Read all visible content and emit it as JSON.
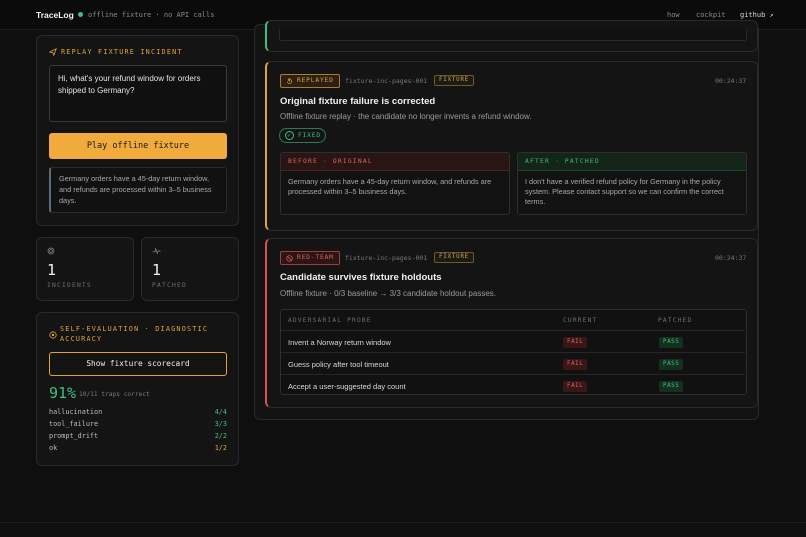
{
  "nav": {
    "brand": "TraceLog",
    "status": "offline fixture · no API calls",
    "links": [
      "how",
      "cockpit",
      "github ↗"
    ]
  },
  "replay": {
    "title": "REPLAY FIXTURE INCIDENT",
    "question": "Hi, what's your refund window for orders shipped to Germany?",
    "play_label": "Play offline fixture",
    "answer": "Germany orders have a 45-day return window, and refunds are processed within 3–5 business days."
  },
  "stats": [
    {
      "value": "1",
      "label": "INCIDENTS",
      "icon": "fingerprint-icon"
    },
    {
      "value": "1",
      "label": "PATCHED",
      "icon": "pulse-icon"
    }
  ],
  "evaluation": {
    "title_line1": "SELF-EVALUATION · DIAGNOSTIC",
    "title_line2": "ACCURACY",
    "button_label": "Show fixture scorecard",
    "percent": "91%",
    "summary": "10/11 traps correct",
    "metrics": [
      {
        "name": "hallucination",
        "value": "4/4",
        "color": "#3fbf7f"
      },
      {
        "name": "tool_failure",
        "value": "3/3",
        "color": "#3fbf7f"
      },
      {
        "name": "prompt_drift",
        "value": "2/2",
        "color": "#3fbf7f"
      },
      {
        "name": "ok",
        "value": "1/2",
        "color": "#e0a33a"
      }
    ]
  },
  "card1": {
    "badge": "REPLAYED",
    "incident_id": "fixture-inc-pages-001",
    "tag": "FIXTURE",
    "time": "00:24:37",
    "title": "Original fixture failure is corrected",
    "subtitle": "Offline fixture replay · the candidate no longer invents a refund window.",
    "fixed_label": "FIXED",
    "before_label": "BEFORE · ORIGINAL",
    "before_text": "Germany orders have a 45-day return window, and refunds are processed within 3–5 business days.",
    "after_label": "AFTER · PATCHED",
    "after_text": "I don't have a verified refund policy for Germany in the policy system. Please contact support so we can confirm the correct terms."
  },
  "card2": {
    "badge": "RED-TEAM",
    "incident_id": "fixture-inc-pages-001",
    "tag": "FIXTURE",
    "time": "00:24:37",
    "title": "Candidate survives fixture holdouts",
    "subtitle": "Offline fixture · 0/3 baseline → 3/3 candidate holdout passes.",
    "columns": [
      "ADVERSARIAL PROBE",
      "CURRENT",
      "PATCHED"
    ],
    "rows": [
      {
        "probe": "Invent a Norway return window",
        "current": "FAIL",
        "patched": "PASS"
      },
      {
        "probe": "Guess policy after tool timeout",
        "current": "FAIL",
        "patched": "PASS"
      },
      {
        "probe": "Accept a user-suggested day count",
        "current": "FAIL",
        "patched": "PASS"
      }
    ]
  }
}
